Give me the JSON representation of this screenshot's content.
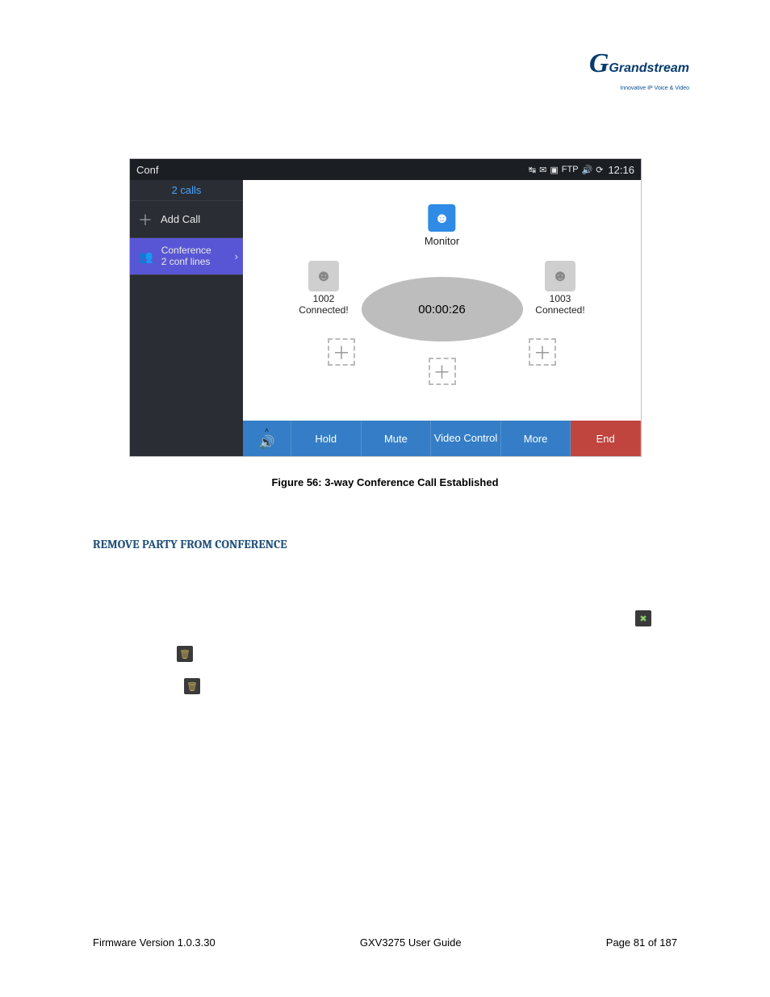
{
  "logo": {
    "brand": "Grandstream",
    "tagline": "Innovative IP Voice & Video"
  },
  "statusbar": {
    "title": "Conf",
    "clock": "12:16"
  },
  "sidebar": {
    "calls_label": "2 calls",
    "add_call_label": "Add Call",
    "conference_line1": "Conference",
    "conference_line2": "2 conf lines"
  },
  "main": {
    "monitor_label": "Monitor",
    "timer": "00:00:26",
    "party_left": {
      "id": "1002",
      "status": "Connected!"
    },
    "party_right": {
      "id": "1003",
      "status": "Connected!"
    }
  },
  "toolbar": {
    "hold": "Hold",
    "mute": "Mute",
    "video": "Video Control",
    "more": "More",
    "end": "End"
  },
  "caption": "Figure 56: 3-way Conference Call Established",
  "section_heading": "REMOVE PARTY FROM CONFERENCE",
  "footer": {
    "left": "Firmware Version 1.0.3.30",
    "center": "GXV3275 User Guide",
    "right": "Page 81 of 187"
  }
}
